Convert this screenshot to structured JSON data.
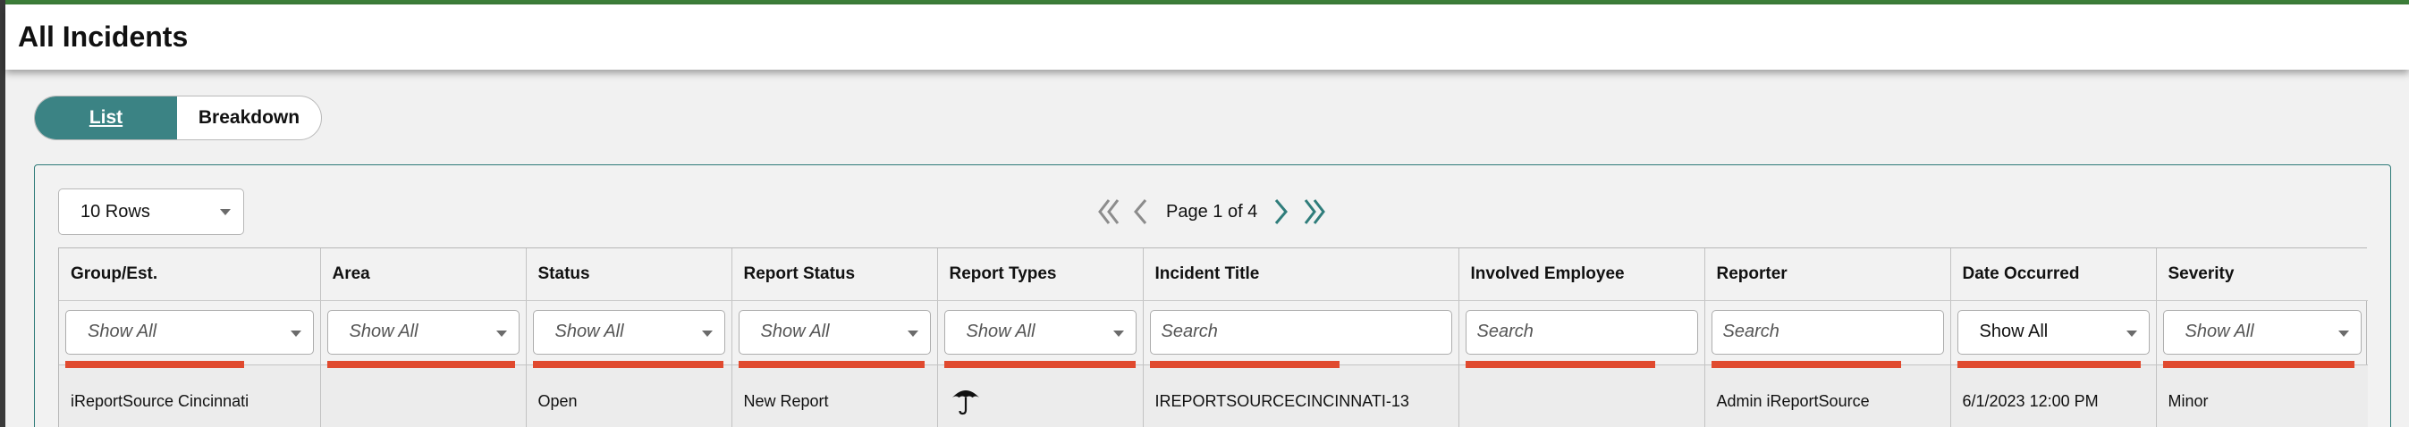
{
  "page": {
    "title": "All Incidents"
  },
  "view_toggle": {
    "list_label": "List",
    "breakdown_label": "Breakdown"
  },
  "toolbar": {
    "rows_selected": "10 Rows",
    "page_label": "Page 1 of 4"
  },
  "table": {
    "columns": [
      "Group/Est.",
      "Area",
      "Status",
      "Report Status",
      "Report Types",
      "Incident Title",
      "Involved Employee",
      "Reporter",
      "Date Occurred",
      "Severity"
    ],
    "filters": [
      {
        "type": "select",
        "value": "Show All"
      },
      {
        "type": "select",
        "value": "Show All"
      },
      {
        "type": "select",
        "value": "Show All"
      },
      {
        "type": "select",
        "value": "Show All"
      },
      {
        "type": "select",
        "value": "Show All"
      },
      {
        "type": "search",
        "placeholder": "Search"
      },
      {
        "type": "search",
        "placeholder": "Search"
      },
      {
        "type": "search",
        "placeholder": "Search"
      },
      {
        "type": "select",
        "value": "Show All"
      },
      {
        "type": "select",
        "value": "Show All"
      }
    ],
    "rows": [
      {
        "group": "iReportSource Cincinnati",
        "area": "",
        "status": "Open",
        "report_status": "New Report",
        "report_type_icon": "umbrella-icon",
        "incident_title": "IREPORTSOURCECINCINNATI-13",
        "involved_employee": "",
        "reporter": "Admin iReportSource",
        "date_occurred": "6/1/2023 12:00 PM",
        "severity": "Minor"
      }
    ]
  },
  "colors": {
    "accent": "#3b8384",
    "filter_underline": "#e04a2f",
    "top_bar": "#3d7f3a"
  }
}
